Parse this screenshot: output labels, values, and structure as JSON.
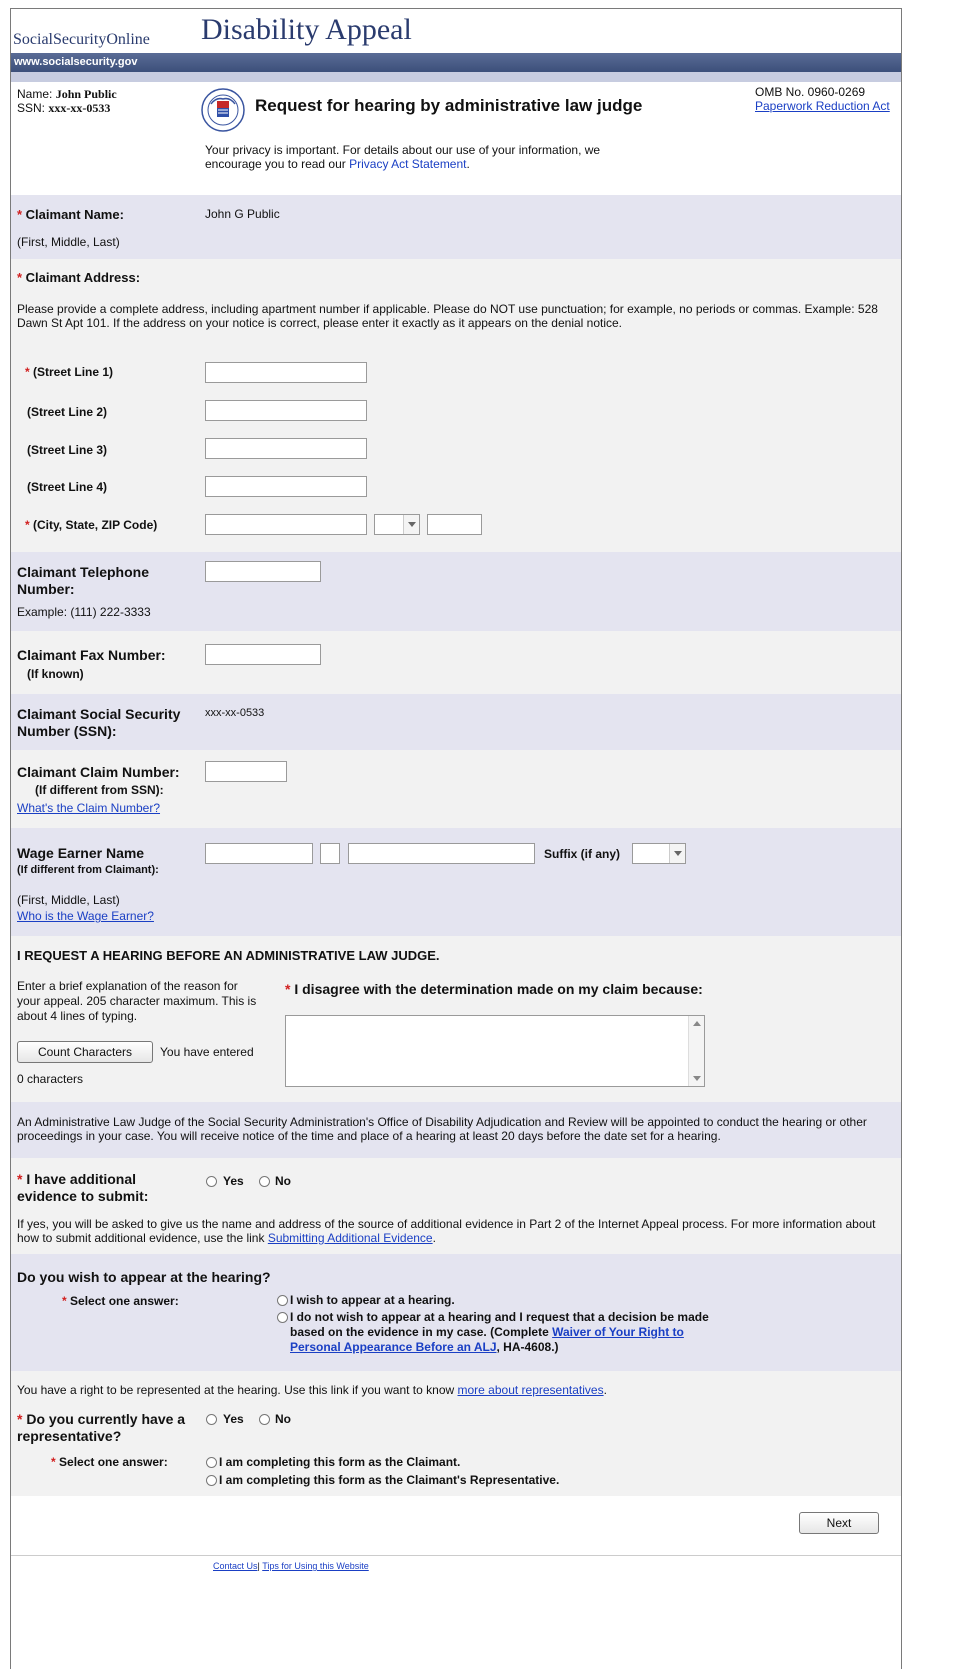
{
  "header": {
    "site_name": "SocialSecurityOnline",
    "page_title": "Disability Appeal",
    "site_url": "www.socialsecurity.gov",
    "name_label": "Name:",
    "name_value": "John Public",
    "ssn_label": "SSN:",
    "ssn_value": "xxx-xx-0533",
    "form_title": "Request for hearing by administrative law judge",
    "omb": "OMB No. 0960-0269",
    "paperwork_link": "Paperwork Reduction Act",
    "privacy_text": "Your privacy is important. For details about our use of your information, we encourage you to read our",
    "privacy_link": "Privacy Act Statement",
    "logo_text": "SOCIAL SECURITY ADMINISTRATION USA"
  },
  "claimant_name": {
    "label": "Claimant Name:",
    "hint": "(First, Middle, Last)",
    "value": "John G Public"
  },
  "address": {
    "label": "Claimant Address:",
    "instructions": "Please provide a complete address, including apartment number if applicable. Please do NOT use punctuation; for example, no periods or commas. Example: 528 Dawn St Apt 101. If the address on your notice is correct, please enter it exactly as it appears on the denial notice.",
    "street1": "(Street Line 1)",
    "street2": "(Street Line 2)",
    "street3": "(Street Line 3)",
    "street4": "(Street Line 4)",
    "city_state_zip": "(City, State, ZIP Code)"
  },
  "telephone": {
    "label": "Claimant Telephone Number:",
    "example": "Example: (111) 222-3333"
  },
  "fax": {
    "label": "Claimant Fax Number:",
    "hint": "(If known)"
  },
  "ssn": {
    "label": "Claimant Social Security Number (SSN):",
    "value": "xxx-xx-0533"
  },
  "claim_number": {
    "label": "Claimant Claim Number:",
    "hint": "(If different from SSN):",
    "link": "What's the Claim Number?"
  },
  "wage_earner": {
    "label": "Wage Earner Name",
    "hint": "(If different from Claimant):",
    "suffix_label": "Suffix (if any)",
    "name_hint": "(First, Middle, Last)",
    "link": "Who is the Wage Earner?"
  },
  "hearing_request": {
    "heading": "I REQUEST A HEARING BEFORE  AN ADMINISTRATIVE LAW JUDGE.",
    "explanation": "Enter a brief explanation of the reason for your appeal. 205 character maximum. This is about 4 lines of typing.",
    "count_button": "Count Characters",
    "entered_text": "You have entered",
    "char_count": "0 characters",
    "disagree_label": "I disagree with the determination made on my claim because:"
  },
  "alj_notice": "An Administrative Law Judge of the Social Security Administration's Office of Disability Adjudication and Review will be appointed to conduct the hearing or other proceedings in your case. You will receive notice of the time and place of a hearing at least 20 days before the date set for a hearing.",
  "evidence": {
    "label": "I have additional evidence to submit:",
    "yes": "Yes",
    "no": "No",
    "info": "If yes, you will be asked to give us the name and address of the source of additional evidence in Part 2 of the Internet Appeal process. For more information about how to submit additional evidence, use the link",
    "link": "Submitting Additional Evidence"
  },
  "appear": {
    "heading": "Do you wish to appear at the hearing?",
    "select_label": "Select one answer:",
    "option1": "I wish to appear at a hearing.",
    "option2_a": "I do not wish to appear at a hearing and I request that a decision be made based on the evidence in my case. (Complete",
    "option2_link": "Waiver of Your Right to Personal Appearance Before an ALJ",
    "option2_b": ", HA-4608.)"
  },
  "representative": {
    "info": "You have a right to be represented at the hearing. Use this link if you want to know",
    "info_link": "more about representatives",
    "label": "Do you currently have a representative?",
    "yes": "Yes",
    "no": "No",
    "select_label": "Select one answer:",
    "option1": "I am completing this form as the Claimant.",
    "option2": "I am completing this form as the Claimant's Representative."
  },
  "footer": {
    "next_button": "Next",
    "contact_link": "Contact Us",
    "tips_link": "Tips for Using this Website"
  },
  "colors": {
    "banner": "#3c4f7a",
    "lavender_row": "#e4e4f0",
    "gray_row": "#f2f2f2",
    "link": "#1a3fc4",
    "required": "#d12020"
  }
}
